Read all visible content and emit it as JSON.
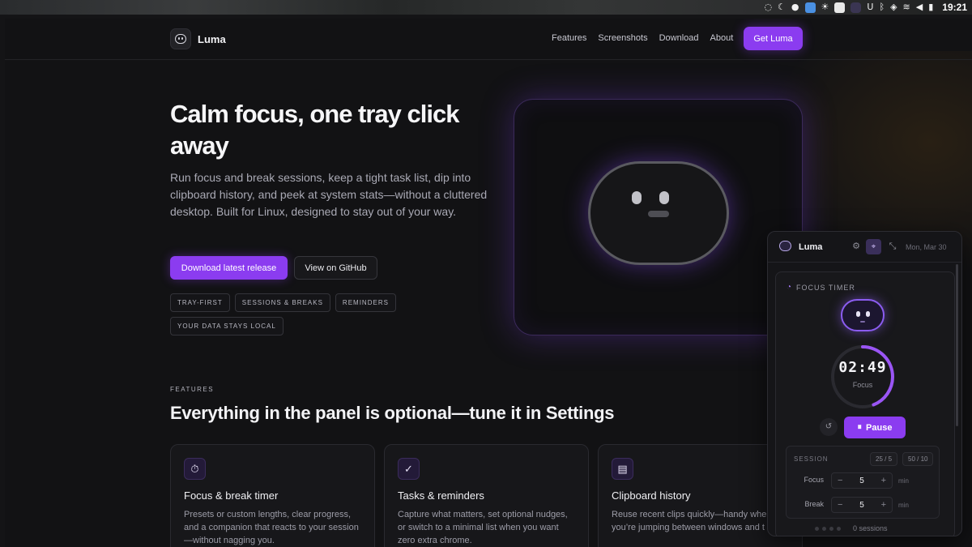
{
  "system_tray": {
    "clock": "19:21"
  },
  "nav": {
    "brand": "Luma",
    "links": [
      "Features",
      "Screenshots",
      "Download",
      "About"
    ],
    "cta": "Get Luma"
  },
  "hero": {
    "title": "Calm focus, one tray click away",
    "subtitle": "Run focus and break sessions, keep a tight task list, dip into clipboard history, and peek at system stats—without a cluttered desktop. Built for Linux, designed to stay out of your way.",
    "primary_button": "Download latest release",
    "secondary_button": "View on GitHub",
    "tags": [
      "TRAY-FIRST",
      "SESSIONS & BREAKS",
      "REMINDERS",
      "YOUR DATA STAYS LOCAL"
    ]
  },
  "features": {
    "eyebrow": "FEATURES",
    "title": "Everything in the panel is optional—tune it in Settings",
    "cards": [
      {
        "icon": "stopwatch-icon",
        "title": "Focus & break timer",
        "desc": "Presets or custom lengths, clear progress, and a companion that reacts to your session—without nagging you."
      },
      {
        "icon": "checkmark-icon",
        "title": "Tasks & reminders",
        "desc": "Capture what matters, set optional nudges, or switch to a minimal list when you want zero extra chrome."
      },
      {
        "icon": "clipboard-icon",
        "title": "Clipboard history",
        "desc": "Reuse recent clips quickly—handy when you’re jumping between windows and t"
      }
    ]
  },
  "panel": {
    "name": "Luma",
    "date": "Mon, Mar 30",
    "timer_label": "FOCUS TIMER",
    "time": "02:49",
    "mode": "Focus",
    "progress": 0.44,
    "pause_label": "Pause",
    "session_label": "SESSION",
    "presets": [
      "25 / 5",
      "50 / 10"
    ],
    "focus_label": "Focus",
    "focus_value": "5",
    "break_label": "Break",
    "break_value": "5",
    "unit": "min",
    "sessions_text": "0 sessions"
  },
  "colors": {
    "accent": "#8b3cf0",
    "background": "#121214"
  }
}
